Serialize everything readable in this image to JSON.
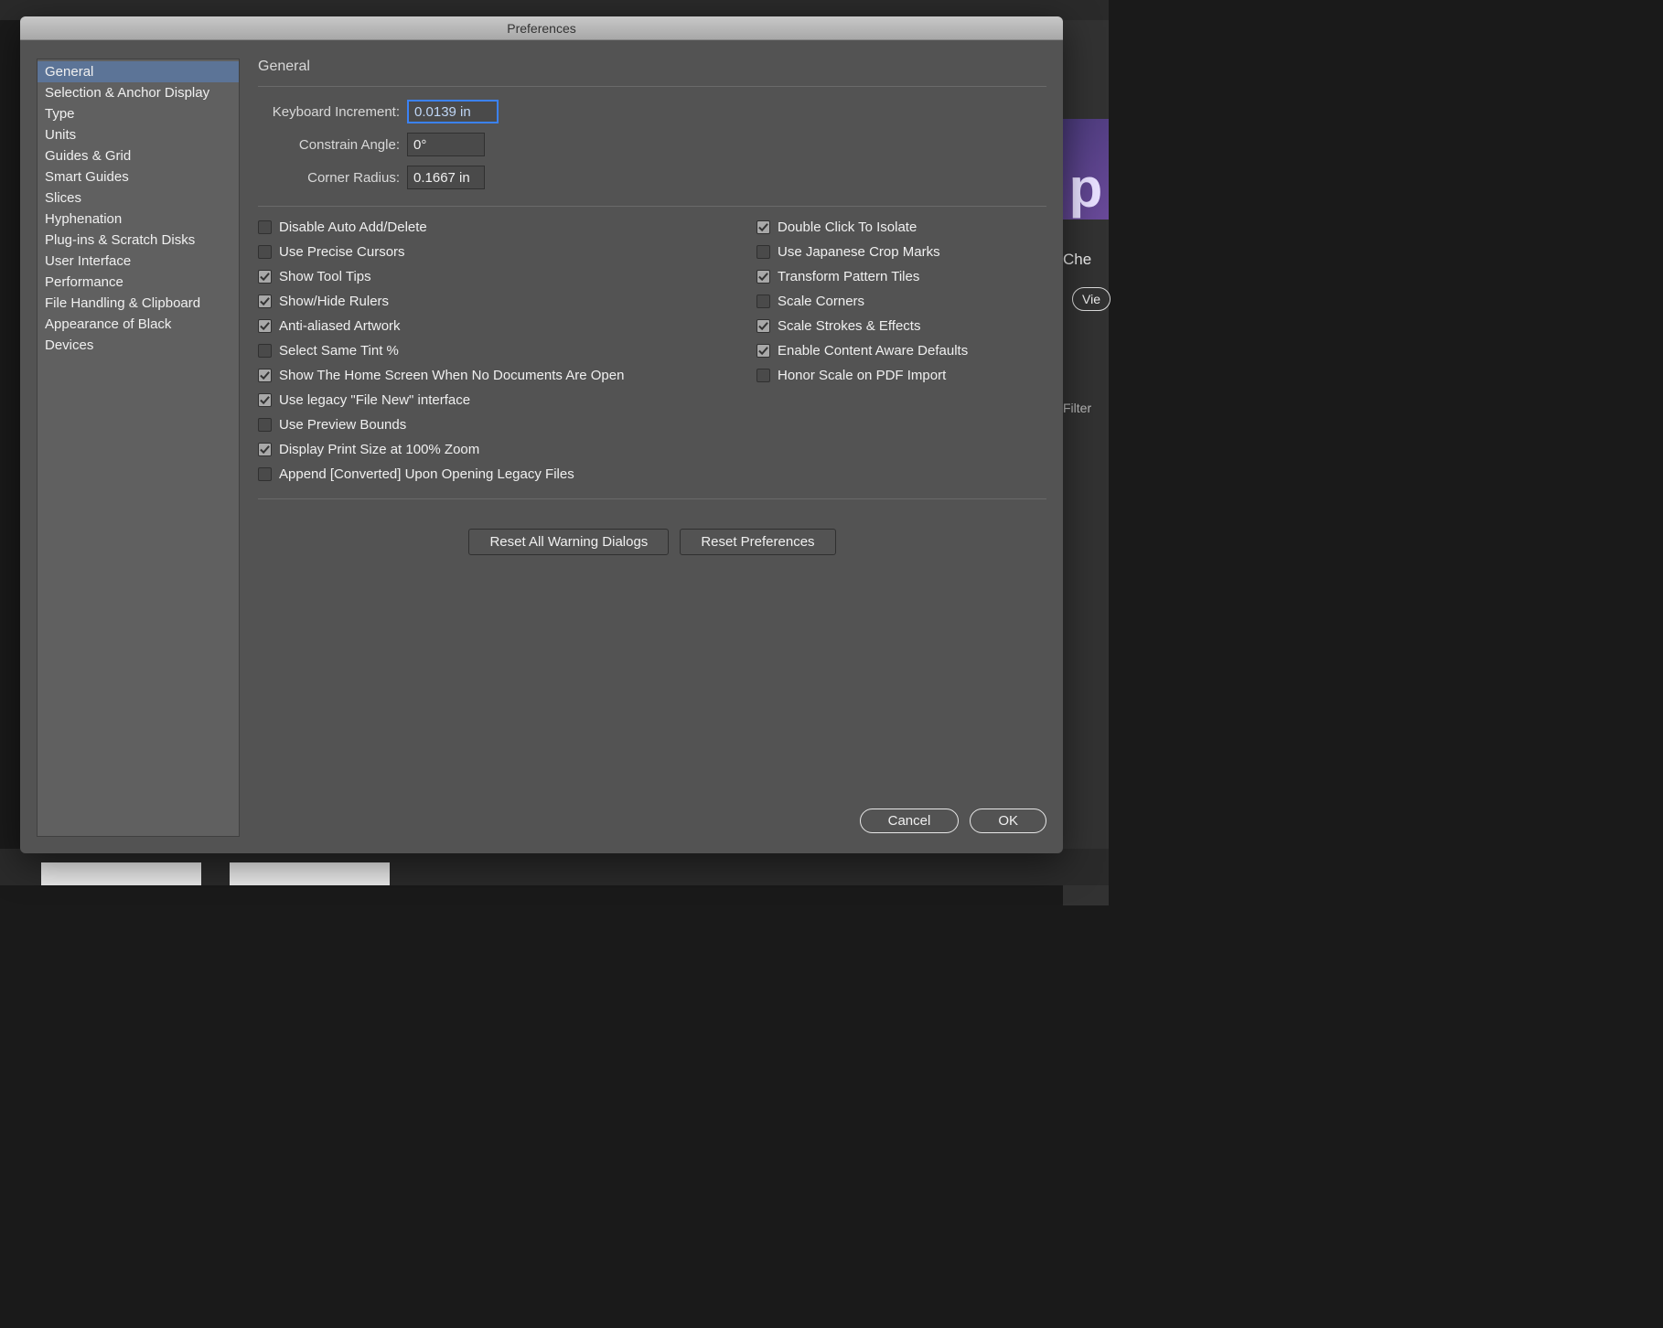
{
  "dialog": {
    "title": "Preferences"
  },
  "sidebar": {
    "items": [
      {
        "label": "General",
        "selected": true
      },
      {
        "label": "Selection & Anchor Display",
        "selected": false
      },
      {
        "label": "Type",
        "selected": false
      },
      {
        "label": "Units",
        "selected": false
      },
      {
        "label": "Guides & Grid",
        "selected": false
      },
      {
        "label": "Smart Guides",
        "selected": false
      },
      {
        "label": "Slices",
        "selected": false
      },
      {
        "label": "Hyphenation",
        "selected": false
      },
      {
        "label": "Plug-ins & Scratch Disks",
        "selected": false
      },
      {
        "label": "User Interface",
        "selected": false
      },
      {
        "label": "Performance",
        "selected": false
      },
      {
        "label": "File Handling & Clipboard",
        "selected": false
      },
      {
        "label": "Appearance of Black",
        "selected": false
      },
      {
        "label": "Devices",
        "selected": false
      }
    ]
  },
  "panel": {
    "title": "General",
    "fields": {
      "keyboard_increment": {
        "label": "Keyboard Increment:",
        "value": "0.0139 in"
      },
      "constrain_angle": {
        "label": "Constrain Angle:",
        "value": "0°"
      },
      "corner_radius": {
        "label": "Corner Radius:",
        "value": "0.1667 in"
      }
    },
    "checkboxes_left": [
      {
        "label": "Disable Auto Add/Delete",
        "checked": false
      },
      {
        "label": "Use Precise Cursors",
        "checked": false
      },
      {
        "label": "Show Tool Tips",
        "checked": true
      },
      {
        "label": "Show/Hide Rulers",
        "checked": true
      },
      {
        "label": "Anti-aliased Artwork",
        "checked": true
      },
      {
        "label": "Select Same Tint %",
        "checked": false
      },
      {
        "label": "Show The Home Screen When No Documents Are Open",
        "checked": true
      },
      {
        "label": "Use legacy \"File New\" interface",
        "checked": true
      },
      {
        "label": "Use Preview Bounds",
        "checked": false
      },
      {
        "label": "Display Print Size at 100% Zoom",
        "checked": true
      },
      {
        "label": "Append [Converted] Upon Opening Legacy Files",
        "checked": false
      }
    ],
    "checkboxes_right": [
      {
        "label": "Double Click To Isolate",
        "checked": true
      },
      {
        "label": "Use Japanese Crop Marks",
        "checked": false
      },
      {
        "label": "Transform Pattern Tiles",
        "checked": true
      },
      {
        "label": "Scale Corners",
        "checked": false
      },
      {
        "label": "Scale Strokes & Effects",
        "checked": true
      },
      {
        "label": "Enable Content Aware Defaults",
        "checked": true
      },
      {
        "label": "Honor Scale on PDF Import",
        "checked": false
      }
    ],
    "reset_warnings": "Reset All Warning Dialogs",
    "reset_prefs": "Reset Preferences",
    "cancel": "Cancel",
    "ok": "OK"
  },
  "background": {
    "thumb_letter": "p",
    "side_check": "Che",
    "side_view": "Vie",
    "side_filter": "Filter"
  }
}
